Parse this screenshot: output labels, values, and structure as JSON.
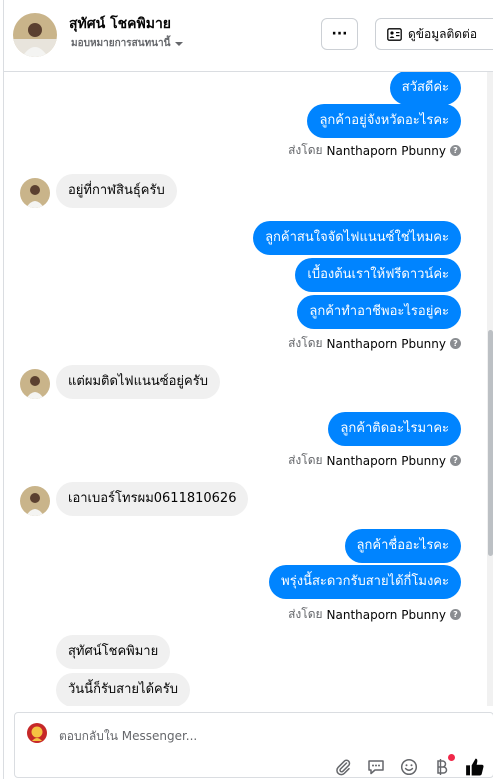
{
  "header": {
    "contact_name": "สุทัศน์ โชคพิมาย",
    "assign_label": "มอบหมายการสนทนานี้",
    "more_label": "···",
    "view_contact_label": "ดูข้อมูลติดต่อ"
  },
  "messages": [
    {
      "dir": "out",
      "text": "สวัสดีค่ะ"
    },
    {
      "dir": "out",
      "text": "ลูกค้าอยู่จังหวัดอะไรคะ"
    },
    {
      "sent_by": "ส่งโดย",
      "sender": "Nanthaporn Pbunny"
    },
    {
      "dir": "in",
      "text": "อยู่ที่กาฬสินธุ์ครับ"
    },
    {
      "dir": "out",
      "text": "ลูกค้าสนใจจัดไฟแนนซ์ใช่ไหมคะ"
    },
    {
      "dir": "out",
      "text": "เบื้องต้นเราให้ฟรีดาวน์ค่ะ"
    },
    {
      "dir": "out",
      "text": "ลูกค้าทำอาชีพอะไรอยู่คะ"
    },
    {
      "sent_by": "ส่งโดย",
      "sender": "Nanthaporn Pbunny"
    },
    {
      "dir": "in",
      "text": "แต่ผมติดไฟแนนซ์อยู่ครับ"
    },
    {
      "dir": "out",
      "text": "ลูกค้าติดอะไรมาคะ"
    },
    {
      "sent_by": "ส่งโดย",
      "sender": "Nanthaporn Pbunny"
    },
    {
      "dir": "in",
      "text": "เอาเบอร์โทรผม0611810626"
    },
    {
      "dir": "out",
      "text": "ลูกค้าชื่ออะไรคะ"
    },
    {
      "dir": "out",
      "text": "พรุ่งนี้สะดวกรับสายได้กี่โมงคะ"
    },
    {
      "sent_by": "ส่งโดย",
      "sender": "Nanthaporn Pbunny"
    },
    {
      "dir": "in",
      "text": "สุทัศน์โชคพิมาย"
    },
    {
      "dir": "in",
      "text": "วันนี้ก็รับสายได้ครับ"
    }
  ],
  "composer": {
    "placeholder": "ตอบกลับใน Messenger..."
  },
  "icons": [
    "attach-icon",
    "saved-reply-icon",
    "emoji-icon",
    "payment-icon",
    "thumbs-up-icon"
  ],
  "colors": {
    "outgoing": "#0084ff",
    "incoming": "#f0f0f0",
    "badge": "#f02849"
  }
}
